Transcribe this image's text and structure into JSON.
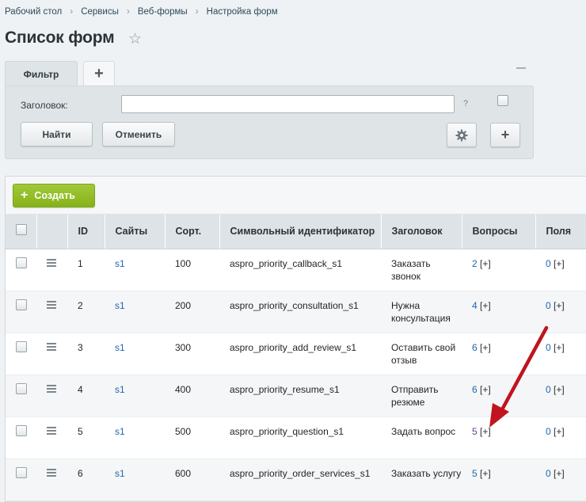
{
  "breadcrumbs": [
    "Рабочий стол",
    "Сервисы",
    "Веб-формы",
    "Настройка форм"
  ],
  "title": "Список форм",
  "filter": {
    "tab_label": "Фильтр",
    "add_tab": "+",
    "field_label": "Заголовок:",
    "field_value": "",
    "help": "?",
    "find_label": "Найти",
    "cancel_label": "Отменить",
    "plus_label": "+"
  },
  "toolbar": {
    "create_label": "Создать",
    "create_plus": "+"
  },
  "table": {
    "headers": {
      "id": "ID",
      "sites": "Сайты",
      "sort": "Сорт.",
      "code": "Символьный идентификатор",
      "title": "Заголовок",
      "questions": "Вопросы",
      "fields": "Поля"
    },
    "rows": [
      {
        "id": "1",
        "site": "s1",
        "sort": "100",
        "code": "aspro_priority_callback_s1",
        "title": "Заказать звонок",
        "questions": "2",
        "fields": "0",
        "add": "[+]"
      },
      {
        "id": "2",
        "site": "s1",
        "sort": "200",
        "code": "aspro_priority_consultation_s1",
        "title": "Нужна консультация",
        "questions": "4",
        "fields": "0",
        "add": "[+]"
      },
      {
        "id": "3",
        "site": "s1",
        "sort": "300",
        "code": "aspro_priority_add_review_s1",
        "title": "Оставить свой отзыв",
        "questions": "6",
        "fields": "0",
        "add": "[+]"
      },
      {
        "id": "4",
        "site": "s1",
        "sort": "400",
        "code": "aspro_priority_resume_s1",
        "title": "Отправить резюме",
        "questions": "6",
        "fields": "0",
        "add": "[+]"
      },
      {
        "id": "5",
        "site": "s1",
        "sort": "500",
        "code": "aspro_priority_question_s1",
        "title": "Задать вопрос",
        "questions": "5",
        "fields": "0",
        "add": "[+]"
      },
      {
        "id": "6",
        "site": "s1",
        "sort": "600",
        "code": "aspro_priority_order_services_s1",
        "title": "Заказать услугу",
        "questions": "5",
        "fields": "0",
        "add": "[+]"
      }
    ]
  },
  "colors": {
    "link": "#2067b0",
    "visited_link": "#6b3c8c",
    "create_button": "#8ab71f",
    "annotation_arrow": "#c0141e"
  },
  "icons": {
    "favorite": "star-icon",
    "settings": "gear-icon",
    "drag": "drag-handle-icon"
  }
}
